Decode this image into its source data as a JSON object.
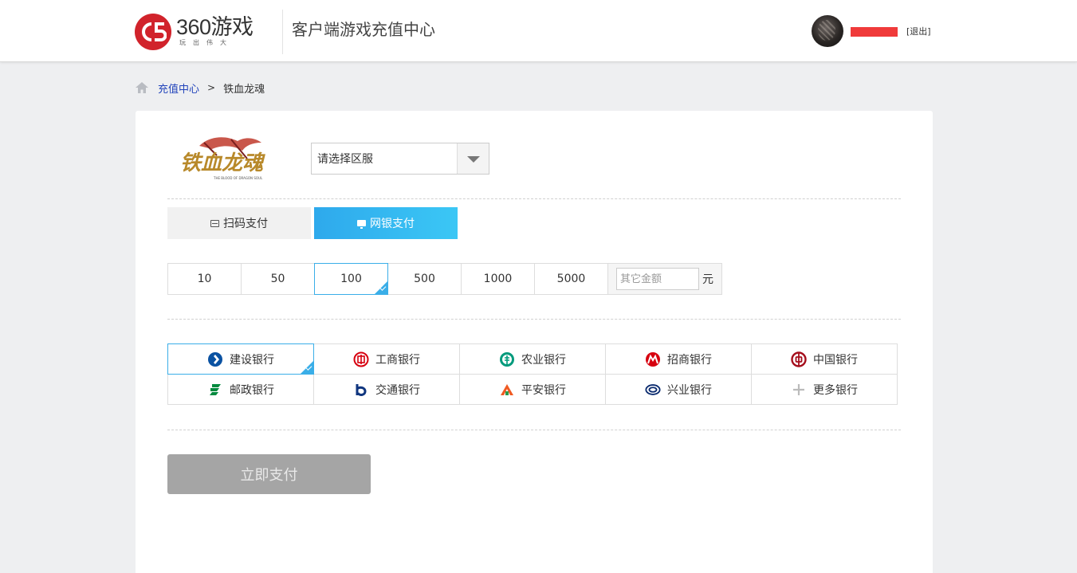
{
  "header": {
    "logo_text": "360游戏",
    "logo_slogan": "玩出伟大",
    "site_title": "客户端游戏充值中心",
    "logout_label": "[退出]",
    "brand_color": "#d1232b",
    "username_mask_color": "#f03a3a"
  },
  "breadcrumb": {
    "home_icon": "home-icon",
    "root_label": "充值中心",
    "separator": ">",
    "current_label": "铁血龙魂"
  },
  "game": {
    "logo_name": "铁血龙魂",
    "logo_subtitle": "THE BLOOD OF DRAGON SOUL"
  },
  "server_select": {
    "placeholder": "请选择区服"
  },
  "pay_tabs": [
    {
      "label": "扫码支付",
      "icon": "qrcode-icon",
      "active": false
    },
    {
      "label": "网银支付",
      "icon": "monitor-icon",
      "active": true
    }
  ],
  "amounts": {
    "options": [
      "10",
      "50",
      "100",
      "500",
      "1000",
      "5000"
    ],
    "selected": "100",
    "other_placeholder": "其它金额",
    "unit": "元"
  },
  "banks": [
    {
      "label": "建设银行",
      "icon": "ccb-icon",
      "selected": true
    },
    {
      "label": "工商银行",
      "icon": "icbc-icon",
      "selected": false
    },
    {
      "label": "农业银行",
      "icon": "abc-icon",
      "selected": false
    },
    {
      "label": "招商银行",
      "icon": "cmb-icon",
      "selected": false
    },
    {
      "label": "中国银行",
      "icon": "boc-icon",
      "selected": false
    },
    {
      "label": "邮政银行",
      "icon": "psbc-icon",
      "selected": false
    },
    {
      "label": "交通银行",
      "icon": "bocom-icon",
      "selected": false
    },
    {
      "label": "平安银行",
      "icon": "pingan-icon",
      "selected": false
    },
    {
      "label": "兴业银行",
      "icon": "cib-icon",
      "selected": false
    },
    {
      "label": "更多银行",
      "icon": "plus-icon",
      "selected": false
    }
  ],
  "pay_button_label": "立即支付",
  "colors": {
    "accent": "#3aaee8",
    "pay_button_disabled": "#a5a5a5"
  }
}
